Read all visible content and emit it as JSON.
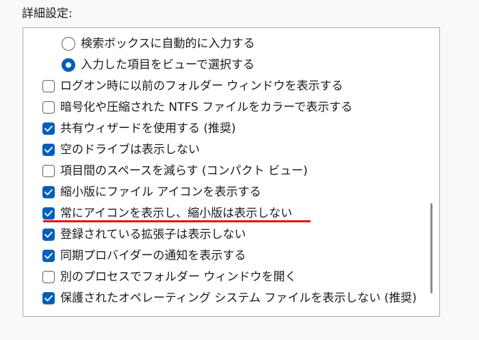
{
  "section": {
    "label": "詳細設定:"
  },
  "items": [
    {
      "type": "radio",
      "checked": false,
      "label": "検索ボックスに自動的に入力する"
    },
    {
      "type": "radio",
      "checked": true,
      "label": "入力した項目をビューで選択する"
    },
    {
      "type": "checkbox",
      "checked": false,
      "label": "ログオン時に以前のフォルダー ウィンドウを表示する"
    },
    {
      "type": "checkbox",
      "checked": false,
      "label": "暗号化や圧縮された NTFS ファイルをカラーで表示する"
    },
    {
      "type": "checkbox",
      "checked": true,
      "label": "共有ウィザードを使用する (推奨)"
    },
    {
      "type": "checkbox",
      "checked": true,
      "label": "空のドライブは表示しない"
    },
    {
      "type": "checkbox",
      "checked": false,
      "label": "項目間のスペースを減らす (コンパクト ビュー)"
    },
    {
      "type": "checkbox",
      "checked": true,
      "label": "縮小版にファイル アイコンを表示する"
    },
    {
      "type": "checkbox",
      "checked": true,
      "label": "常にアイコンを表示し、縮小版は表示しない"
    },
    {
      "type": "checkbox",
      "checked": true,
      "label": "登録されている拡張子は表示しない"
    },
    {
      "type": "checkbox",
      "checked": true,
      "label": "同期プロバイダーの通知を表示する"
    },
    {
      "type": "checkbox",
      "checked": false,
      "label": "別のプロセスでフォルダー ウィンドウを開く"
    },
    {
      "type": "checkbox",
      "checked": true,
      "label": "保護されたオペレーティング システム ファイルを表示しない (推奨)"
    }
  ],
  "colors": {
    "accent": "#005fb8",
    "highlight_underline": "#e60012"
  },
  "icons": {
    "checked": "checkmark-icon"
  }
}
